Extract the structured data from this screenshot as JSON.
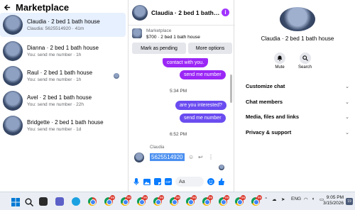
{
  "left": {
    "title": "Marketplace",
    "conversations": [
      {
        "name": "Claudia · 2 bed 1 bath house",
        "sub": "Claudia: 5625514920 · 41m"
      },
      {
        "name": "Dianna · 2 bed 1 bath house",
        "sub": "You: send me number · 1h"
      },
      {
        "name": "Raul · 2 bed 1 bath house",
        "sub": "You: send me number · 1h"
      },
      {
        "name": "Avel · 2 bed 1 bath house",
        "sub": "You: send me number · 22h"
      },
      {
        "name": "Bridgette · 2 bed 1 bath house",
        "sub": "You: send me number · 1d"
      }
    ]
  },
  "middle": {
    "header_name": "Claudia · 2 bed 1 bath…",
    "marketplace_label": "Marketplace",
    "listing": "$700 · 2 bed 1 bath house",
    "mark_pending": "Mark as pending",
    "more_options": "More options",
    "messages": {
      "bubble1": "contact with you.",
      "bubble2": "send me number",
      "time1": "5:34 PM",
      "bubble3": "are you interested?",
      "bubble4": "send me number",
      "time2": "6:52 PM",
      "sender": "Claudia",
      "incoming": "5625514920"
    },
    "composer_placeholder": "Aa"
  },
  "right": {
    "name": "Claudia · 2 bed 1 bath house",
    "mute": "Mute",
    "search": "Search",
    "rows": [
      "Customize chat",
      "Chat members",
      "Media, files and links",
      "Privacy & support"
    ]
  },
  "taskbar": {
    "lang": "ENG",
    "time": "9:05 PM",
    "date": "3/15/2026",
    "notif_count": "19",
    "badge": "99"
  },
  "colors": {
    "accent_purple": "#9b27f6",
    "accent_blue": "#0a7cff",
    "active_row": "#e7f0fe"
  }
}
